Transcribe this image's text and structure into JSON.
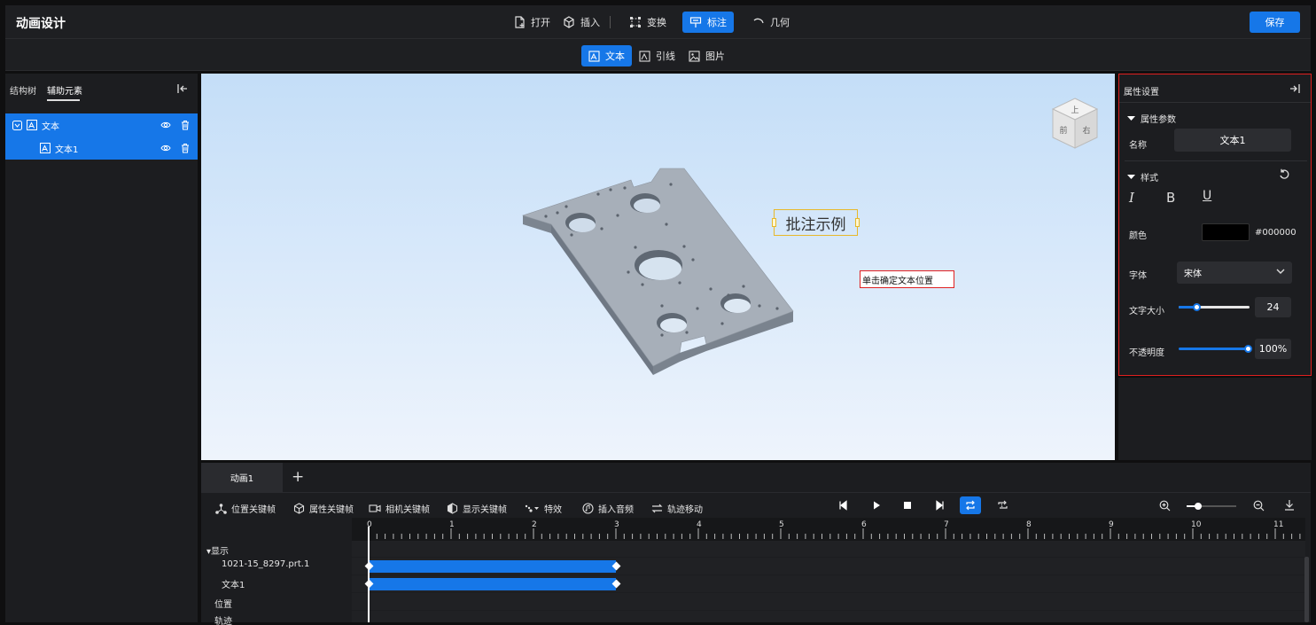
{
  "app": {
    "title": "动画设计"
  },
  "menu": [
    {
      "label": "打开",
      "icon": "open-file-icon"
    },
    {
      "label": "插入",
      "icon": "cube-icon"
    },
    {
      "label": "变换",
      "icon": "transform-icon"
    },
    {
      "label": "标注",
      "icon": "annotation-icon",
      "active": true
    },
    {
      "label": "几何",
      "icon": "arc-icon"
    }
  ],
  "save_label": "保存",
  "subtoolbar": [
    {
      "label": "文本",
      "icon": "text-image-icon",
      "active": true
    },
    {
      "label": "引线",
      "icon": "leader-line-icon"
    },
    {
      "label": "图片",
      "icon": "picture-icon"
    }
  ],
  "left_panel": {
    "tabs": [
      "结构树",
      "辅助元素"
    ],
    "active_tab": "辅助元素",
    "tree": [
      {
        "label": "文本",
        "level": 0,
        "expanded": true
      },
      {
        "label": "文本1",
        "level": 1
      }
    ]
  },
  "viewport": {
    "annotation_text": "批注示例",
    "hint_text": "单击确定文本位置",
    "view_cube_faces": [
      "上",
      "前",
      "右"
    ]
  },
  "properties": {
    "title": "属性设置",
    "params_section": "属性参数",
    "name_label": "名称",
    "name_value": "文本1",
    "style_section": "样式",
    "style_buttons": [
      "I",
      "B",
      "U"
    ],
    "color_label": "颜色",
    "color_value": "#000000",
    "font_label": "字体",
    "font_value": "宋体",
    "font_size_label": "文字大小",
    "font_size_value": "24",
    "opacity_label": "不透明度",
    "opacity_value": "100%",
    "colors": {
      "accent": "#1677e8",
      "highlight_border": "#e02020"
    }
  },
  "timeline": {
    "tab_label": "动画1",
    "add_tab": "+",
    "tools": [
      {
        "label": "位置关键帧",
        "icon": "position-keyframe-icon"
      },
      {
        "label": "属性关键帧",
        "icon": "property-keyframe-icon"
      },
      {
        "label": "相机关键帧",
        "icon": "camera-keyframe-icon"
      },
      {
        "label": "显示关键帧",
        "icon": "display-keyframe-icon"
      },
      {
        "label": "特效",
        "icon": "effects-icon"
      },
      {
        "label": "插入音频",
        "icon": "audio-icon"
      },
      {
        "label": "轨迹移动",
        "icon": "path-move-icon"
      }
    ],
    "ruler_numbers": [
      "0",
      "1",
      "2",
      "3",
      "4",
      "5",
      "6",
      "7",
      "8",
      "9",
      "10",
      "11"
    ],
    "group_label": "▾显示",
    "rows": [
      {
        "label": "1021-15_8297.prt.1",
        "start": 0,
        "end": 3
      },
      {
        "label": "文本1",
        "start": 0,
        "end": 3
      }
    ],
    "extra_rows": [
      "位置",
      "轨迹"
    ]
  }
}
